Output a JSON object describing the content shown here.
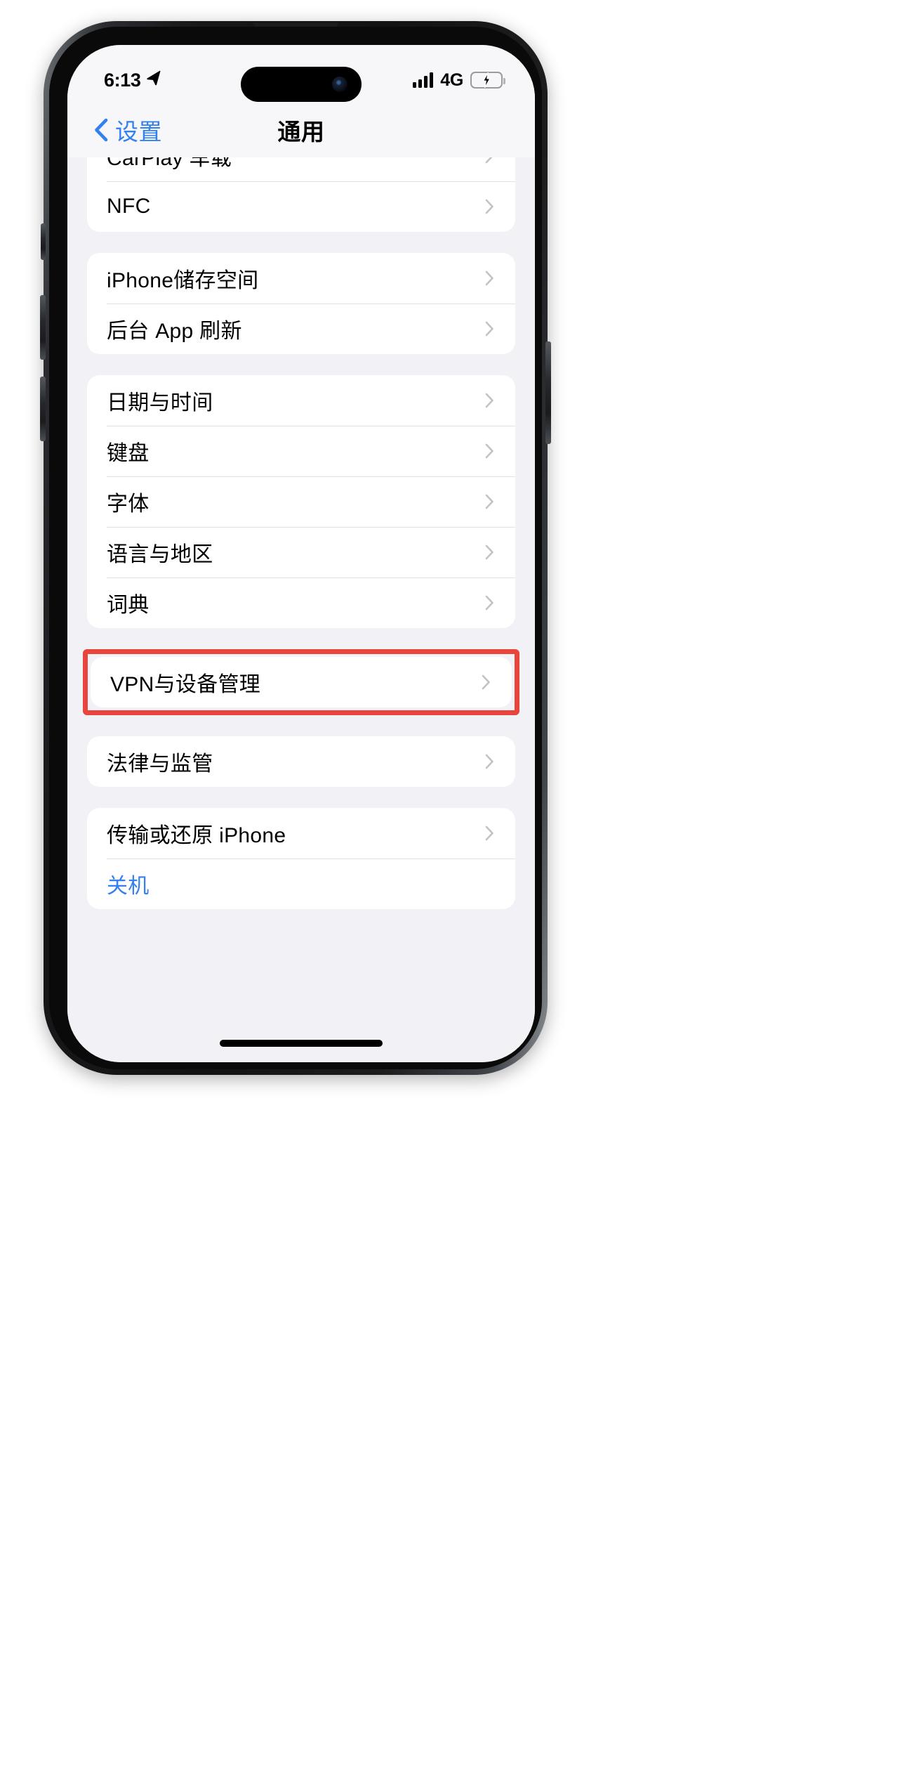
{
  "status_bar": {
    "time": "6:13",
    "location_icon": "location-arrow-icon",
    "signal_icon": "cellular-signal-icon",
    "signal_bars": 4,
    "network_type": "4G",
    "battery_icon": "battery-charging-icon",
    "battery_color": "#3dd862",
    "charging": true
  },
  "nav": {
    "back_label": "设置",
    "back_icon": "chevron-left-icon",
    "title": "通用"
  },
  "colors": {
    "accent_blue": "#3381f0",
    "highlight_red": "#e8453c",
    "page_background": "#f2f1f6",
    "card_background": "#ffffff",
    "separator": "#e2e2e6"
  },
  "groups": [
    {
      "id": "group-carplay",
      "clipped_top": true,
      "rows": [
        {
          "label": "CarPlay 车载",
          "clipped": true,
          "chevron": true,
          "name": "settings-row-carplay"
        },
        {
          "label": "NFC",
          "chevron": true,
          "name": "settings-row-nfc"
        }
      ]
    },
    {
      "id": "group-storage",
      "rows": [
        {
          "label": "iPhone储存空间",
          "chevron": true,
          "name": "settings-row-iphone-storage"
        },
        {
          "label": "后台 App 刷新",
          "chevron": true,
          "name": "settings-row-background-app-refresh"
        }
      ]
    },
    {
      "id": "group-system",
      "rows": [
        {
          "label": "日期与时间",
          "chevron": true,
          "name": "settings-row-date-time"
        },
        {
          "label": "键盘",
          "chevron": true,
          "name": "settings-row-keyboard"
        },
        {
          "label": "字体",
          "chevron": true,
          "name": "settings-row-fonts"
        },
        {
          "label": "语言与地区",
          "chevron": true,
          "name": "settings-row-language-region"
        },
        {
          "label": "词典",
          "chevron": true,
          "name": "settings-row-dictionary"
        }
      ]
    },
    {
      "id": "group-vpn",
      "highlighted": true,
      "rows": [
        {
          "label": "VPN与设备管理",
          "chevron": true,
          "name": "settings-row-vpn-device-management"
        }
      ]
    },
    {
      "id": "group-legal",
      "rows": [
        {
          "label": "法律与监管",
          "chevron": true,
          "name": "settings-row-legal-regulatory"
        }
      ]
    },
    {
      "id": "group-reset",
      "rows": [
        {
          "label": "传输或还原 iPhone",
          "chevron": true,
          "name": "settings-row-transfer-reset-iphone"
        },
        {
          "label": "关机",
          "chevron": false,
          "accent": true,
          "name": "settings-row-shut-down"
        }
      ]
    }
  ]
}
